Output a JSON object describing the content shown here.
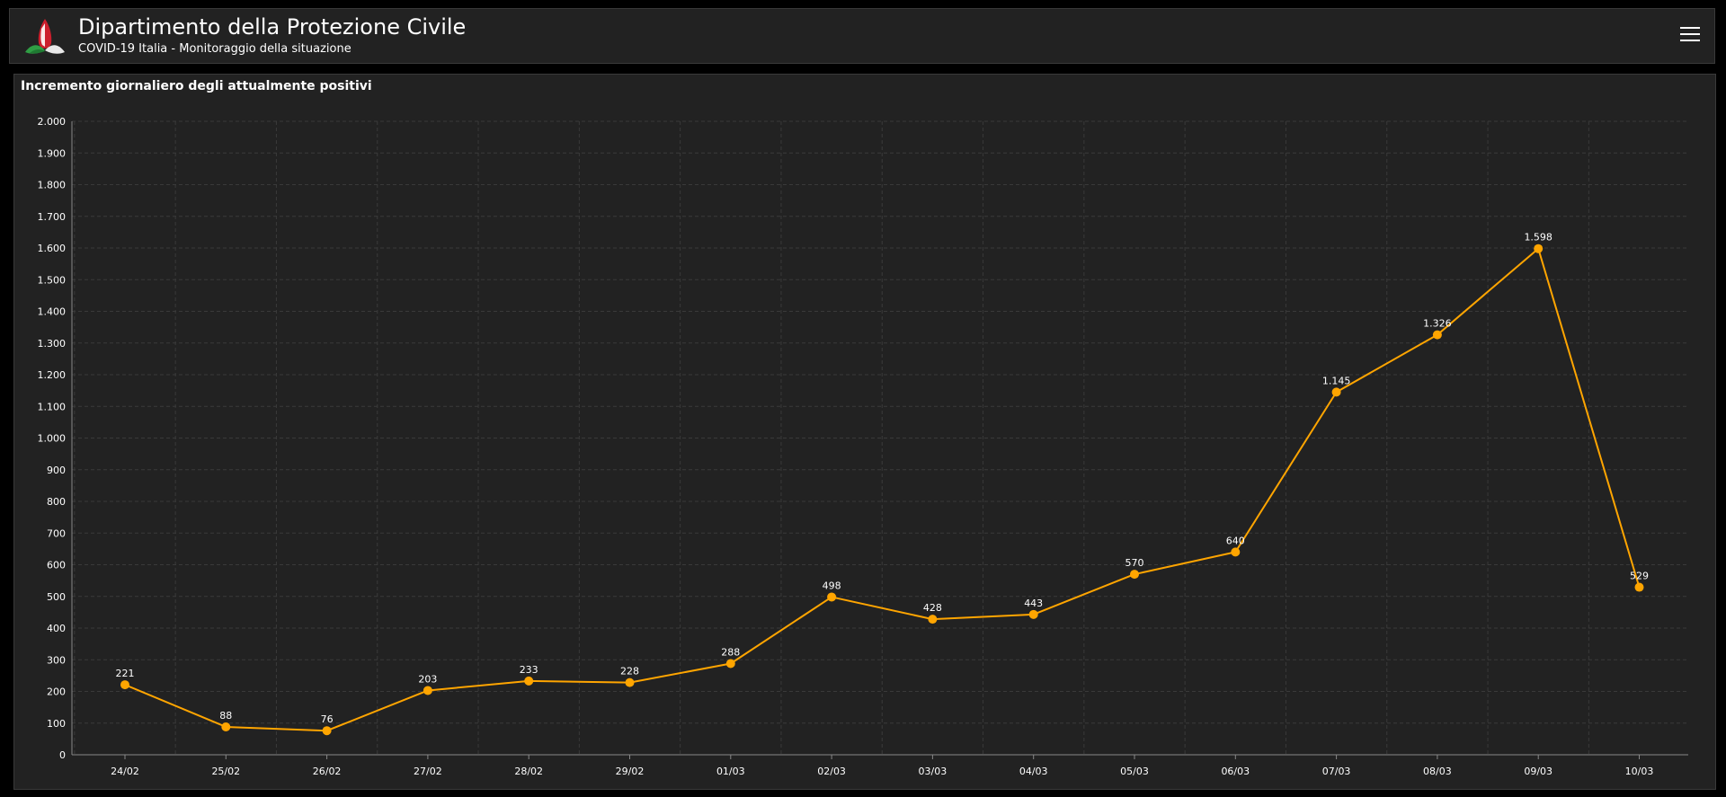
{
  "header": {
    "title": "Dipartimento della Protezione Civile",
    "subtitle": "COVID-19 Italia - Monitoraggio della situazione",
    "logo_icon": "protezione-civile-logo",
    "menu_icon": "hamburger-menu-icon"
  },
  "panel": {
    "title": "Incremento giornaliero degli attualmente positivi"
  },
  "colors": {
    "background": "#000000",
    "panel": "#222222",
    "series": "#ffa500",
    "grid": "#3a3a3a",
    "text": "#ffffff"
  },
  "chart_data": {
    "type": "line",
    "title": "Incremento giornaliero degli attualmente positivi",
    "xlabel": "",
    "ylabel": "",
    "categories": [
      "24/02",
      "25/02",
      "26/02",
      "27/02",
      "28/02",
      "29/02",
      "01/03",
      "02/03",
      "03/03",
      "04/03",
      "05/03",
      "06/03",
      "07/03",
      "08/03",
      "09/03",
      "10/03"
    ],
    "series": [
      {
        "values": [
          221,
          88,
          76,
          203,
          233,
          228,
          288,
          498,
          428,
          443,
          570,
          640,
          1145,
          1326,
          1598,
          529
        ],
        "labels": [
          "221",
          "88",
          "76",
          "203",
          "233",
          "228",
          "288",
          "498",
          "428",
          "443",
          "570",
          "640",
          "1.145",
          "1.326",
          "1.598",
          "529"
        ],
        "color": "#ffa500"
      }
    ],
    "ylim": [
      0,
      2000
    ],
    "yticks": [
      0,
      100,
      200,
      300,
      400,
      500,
      600,
      700,
      800,
      900,
      1000,
      1100,
      1200,
      1300,
      1400,
      1500,
      1600,
      1700,
      1800,
      1900,
      2000
    ],
    "ytick_labels": [
      "0",
      "100",
      "200",
      "300",
      "400",
      "500",
      "600",
      "700",
      "800",
      "900",
      "1.000",
      "1.100",
      "1.200",
      "1.300",
      "1.400",
      "1.500",
      "1.600",
      "1.700",
      "1.800",
      "1.900",
      "2.000"
    ],
    "grid": true,
    "legend": "none"
  }
}
